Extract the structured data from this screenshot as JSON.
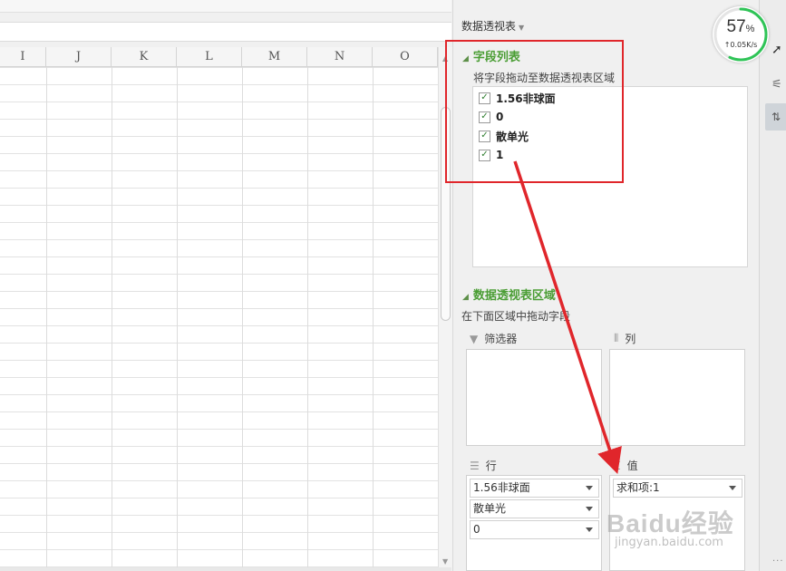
{
  "spreadsheet": {
    "columns": [
      "I",
      "J",
      "K",
      "L",
      "M",
      "N",
      "O"
    ]
  },
  "pivot": {
    "title": "数据透视表",
    "field_list": {
      "heading": "字段列表",
      "hint": "将字段拖动至数据透视表区域",
      "fields": [
        {
          "label": "1.56非球面",
          "checked": true
        },
        {
          "label": "0",
          "checked": true
        },
        {
          "label": "散单光",
          "checked": true
        },
        {
          "label": "1",
          "checked": true
        }
      ]
    },
    "areas": {
      "heading": "数据透视表区域",
      "hint": "在下面区域中拖动字段",
      "filter_label": "筛选器",
      "column_label": "列",
      "row_label": "行",
      "value_label": "值",
      "row_items": [
        "1.56非球面",
        "散单光",
        "0"
      ],
      "value_items": [
        "求和项:1"
      ]
    }
  },
  "speed_widget": {
    "percent": "57",
    "percent_sign": "%",
    "rate": "↑0.05K/s",
    "accent": "#2fc457"
  },
  "annotation": {
    "color": "#e0262b"
  },
  "watermark": {
    "text": "Baidu经验",
    "sub": "jingyan.baidu.com"
  }
}
